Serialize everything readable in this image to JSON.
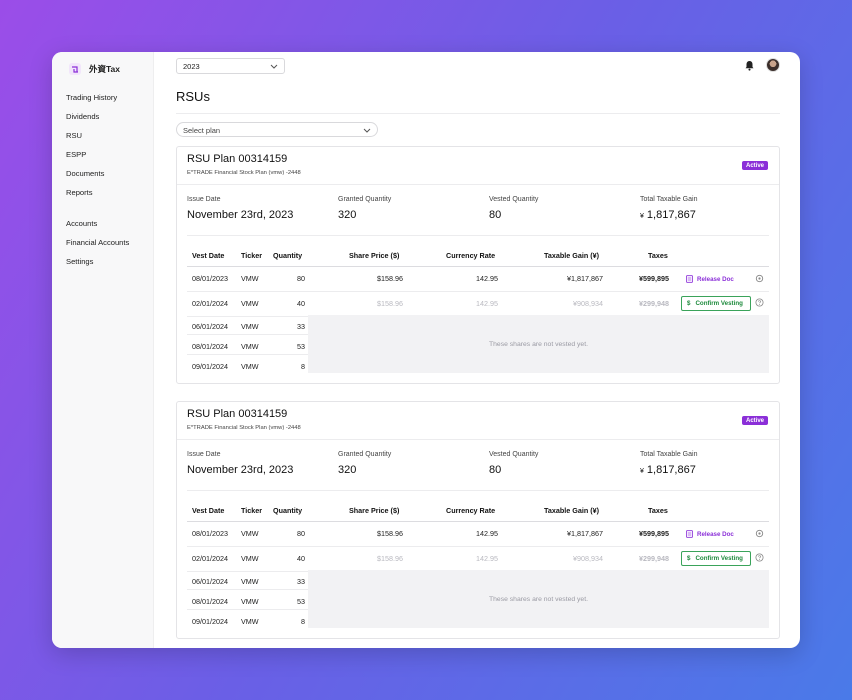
{
  "app": {
    "name": "外資Tax"
  },
  "sidebar": {
    "items": [
      {
        "label": "Trading History"
      },
      {
        "label": "Dividends"
      },
      {
        "label": "RSU"
      },
      {
        "label": "ESPP"
      },
      {
        "label": "Documents"
      },
      {
        "label": "Reports"
      },
      {
        "label": "Accounts"
      },
      {
        "label": "Financial Accounts"
      },
      {
        "label": "Settings"
      }
    ]
  },
  "header": {
    "year": "2023"
  },
  "page": {
    "title": "RSUs",
    "plan_placeholder": "Select plan"
  },
  "table_headers": {
    "vest_date": "Vest Date",
    "ticker": "Ticker",
    "quantity": "Quantity",
    "share_price": "Share Price ($)",
    "currency_rate": "Currency Rate",
    "taxable_gain": "Taxable Gain (¥)",
    "taxes": "Taxes"
  },
  "labels": {
    "issue_date": "Issue Date",
    "granted_quantity": "Granted Quantity",
    "vested_quantity": "Vested Quantity",
    "total_taxable_gain": "Total Taxable Gain",
    "yen_symbol": "¥",
    "release_doc": "Release Doc",
    "confirm_vesting": "Confirm Vesting",
    "dollar_symbol": "$",
    "not_vested": "These shares are not vested yet."
  },
  "plans": [
    {
      "title": "RSU Plan 00314159",
      "subtitle": "E*TRADE Financial Stock Plan (vmw) -2448",
      "status": "Active",
      "issue_date": "November 23rd, 2023",
      "granted_quantity": "320",
      "vested_quantity": "80",
      "total_taxable_gain": "1,817,867",
      "rows": [
        {
          "vest_date": "08/01/2023",
          "ticker": "VMW",
          "quantity": "80",
          "share_price": "$158.96",
          "currency_rate": "142.95",
          "taxable_gain": "¥1,817,867",
          "taxes": "¥599,895"
        },
        {
          "vest_date": "02/01/2024",
          "ticker": "VMW",
          "quantity": "40",
          "share_price": "$158.96",
          "currency_rate": "142.95",
          "taxable_gain": "¥908,934",
          "taxes": "¥299,948"
        },
        {
          "vest_date": "06/01/2024",
          "ticker": "VMW",
          "quantity": "33"
        },
        {
          "vest_date": "08/01/2024",
          "ticker": "VMW",
          "quantity": "53"
        },
        {
          "vest_date": "09/01/2024",
          "ticker": "VMW",
          "quantity": "8"
        }
      ]
    },
    {
      "title": "RSU Plan 00314159",
      "subtitle": "E*TRADE Financial Stock Plan (vmw) -2448",
      "status": "Active",
      "issue_date": "November 23rd, 2023",
      "granted_quantity": "320",
      "vested_quantity": "80",
      "total_taxable_gain": "1,817,867",
      "rows": [
        {
          "vest_date": "08/01/2023",
          "ticker": "VMW",
          "quantity": "80",
          "share_price": "$158.96",
          "currency_rate": "142.95",
          "taxable_gain": "¥1,817,867",
          "taxes": "¥599,895"
        },
        {
          "vest_date": "02/01/2024",
          "ticker": "VMW",
          "quantity": "40",
          "share_price": "$158.96",
          "currency_rate": "142.95",
          "taxable_gain": "¥908,934",
          "taxes": "¥299,948"
        },
        {
          "vest_date": "06/01/2024",
          "ticker": "VMW",
          "quantity": "33"
        },
        {
          "vest_date": "08/01/2024",
          "ticker": "VMW",
          "quantity": "53"
        },
        {
          "vest_date": "09/01/2024",
          "ticker": "VMW",
          "quantity": "8"
        }
      ]
    }
  ],
  "colors": {
    "accent": "#8b2fd8",
    "success": "#1d8a3c"
  }
}
